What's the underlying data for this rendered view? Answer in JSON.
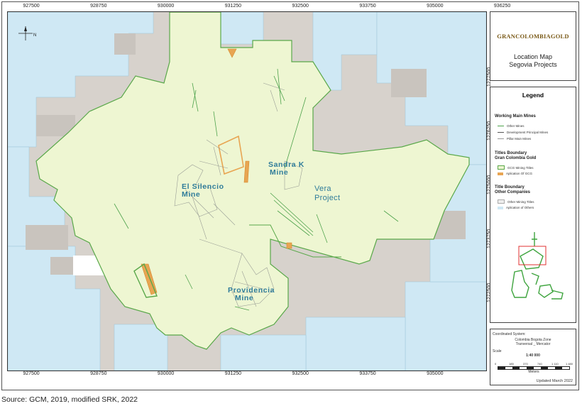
{
  "map": {
    "x_ticks": [
      "927500",
      "928750",
      "930000",
      "931250",
      "932500",
      "933750",
      "935000",
      "936250"
    ],
    "y_ticks": [
      "1277500",
      "1276250",
      "1275000",
      "1273750",
      "1272500"
    ],
    "north_arrow_label": "N",
    "labels": {
      "el_silencio": [
        "El Silencio",
        "Mine"
      ],
      "sandra_k": [
        "Sandra K",
        "Mine"
      ],
      "vera": [
        "Vera",
        "Project"
      ],
      "providencia": [
        "Providencia",
        "Mine"
      ]
    },
    "colors": {
      "title_area": "#eef6d2",
      "other_area": "#cfe8f4",
      "background": "#d7d2cc",
      "gcg_boundary": "#5aa84a",
      "application_gcg": "#e8a552"
    }
  },
  "panel": {
    "logo": "GRANCOLOMBIAGOLD",
    "title_line1": "Location Map",
    "title_line2": "Segovia Projects",
    "legend_title": "Legend",
    "working_section": "Working Main Mines",
    "working_items": [
      "Other Mines",
      "Development Principal Mines",
      "Pillar Main Mines"
    ],
    "titles_section_1": "Titles Boundary",
    "titles_section_2": "Gran Colombia Gold",
    "titles_items": [
      "GCG Mining Titles",
      "Aplication Of GCG"
    ],
    "other_section_1": "Title Boundary",
    "other_section_2": "Other Companies",
    "other_items": [
      "Other Mining Titles",
      "Aplication of Others"
    ],
    "coord_header": "Coordinated System:",
    "coord_line1": "Colombia Bogota Zone",
    "coord_line2": "Tranversal _ Mercator",
    "scale_label": "Scale",
    "scale_ratio": "1:40 000",
    "scale_ticks": [
      "0",
      "185",
      "370",
      "740",
      "1 110",
      "1 480"
    ],
    "scale_units": "Meters",
    "updated": "Updated March 2022"
  },
  "caption": "Source: GCM, 2019, modified SRK, 2022"
}
